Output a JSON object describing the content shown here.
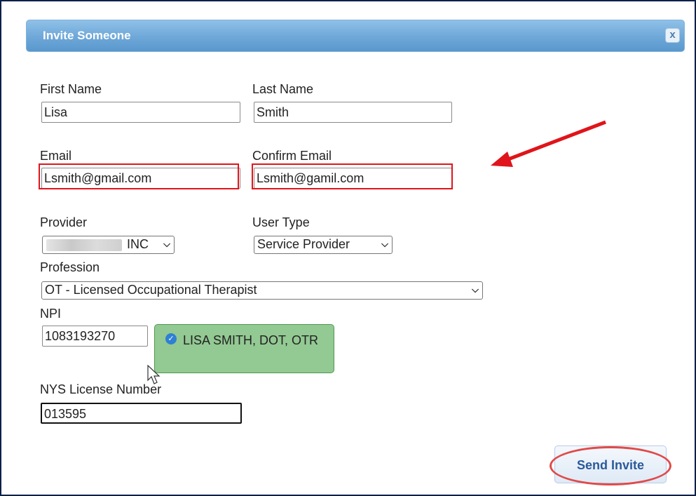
{
  "dialog": {
    "title": "Invite Someone",
    "close_label": "x"
  },
  "form": {
    "first_name": {
      "label": "First Name",
      "value": "Lisa"
    },
    "last_name": {
      "label": "Last Name",
      "value": "Smith"
    },
    "email": {
      "label": "Email",
      "value": "Lsmith@gmail.com"
    },
    "confirm_email": {
      "label": "Confirm Email",
      "value": "Lsmith@gamil.com"
    },
    "provider": {
      "label": "Provider",
      "selected_visible": "INC"
    },
    "user_type": {
      "label": "User Type",
      "selected": "Service Provider"
    },
    "profession": {
      "label": "Profession",
      "selected": "OT - Licensed Occupational Therapist"
    },
    "npi": {
      "label": "NPI",
      "value": "1083193270",
      "verified_text": "LISA SMITH, DOT, OTR"
    },
    "license": {
      "label": "NYS License Number",
      "value": "013595"
    }
  },
  "actions": {
    "send_label": "Send Invite"
  },
  "colors": {
    "highlight_red": "#e0141b",
    "title_blue": "#6ea7d8",
    "verified_green": "#93c993"
  }
}
